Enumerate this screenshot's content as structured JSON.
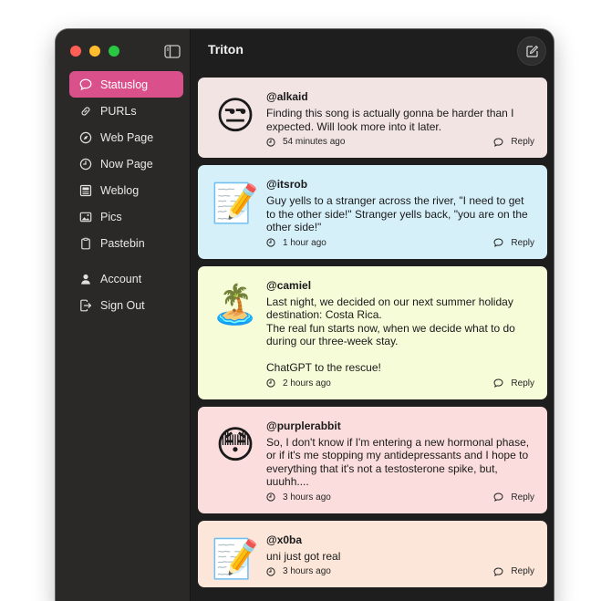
{
  "app": {
    "title": "Triton"
  },
  "sidebar": {
    "items": [
      {
        "label": "Statuslog",
        "icon": "speech-bubble-icon",
        "active": true
      },
      {
        "label": "PURLs",
        "icon": "link-icon"
      },
      {
        "label": "Web Page",
        "icon": "compass-icon"
      },
      {
        "label": "Now Page",
        "icon": "clock-icon"
      },
      {
        "label": "Weblog",
        "icon": "newspaper-icon"
      },
      {
        "label": "Pics",
        "icon": "photo-icon"
      },
      {
        "label": "Pastebin",
        "icon": "clipboard-icon"
      }
    ],
    "account_items": [
      {
        "label": "Account",
        "icon": "person-icon"
      },
      {
        "label": "Sign Out",
        "icon": "sign-out-icon"
      }
    ]
  },
  "feed": {
    "reply_label": "Reply",
    "posts": [
      {
        "handle": "@alkaid",
        "avatar": "😒",
        "text": "Finding this song is actually gonna be harder than I expected. Will look more into it later.",
        "time": "54 minutes ago",
        "bg": "#f3e4e4"
      },
      {
        "handle": "@itsrob",
        "avatar": "📝",
        "text": "Guy yells to a stranger across the river, \"I need to get to the other side!\" Stranger yells back, \"you are on the other side!\"",
        "time": "1 hour ago",
        "bg": "#d6f0fa"
      },
      {
        "handle": "@camiel",
        "avatar": "🏝️",
        "text": "Last night, we decided on our next summer holiday destination: Costa Rica.\nThe real fun starts now, when we decide what to do during our three-week stay.\n\nChatGPT to the rescue!",
        "time": "2 hours ago",
        "bg": "#f6fbd8"
      },
      {
        "handle": "@purplerabbit",
        "avatar": "😳",
        "text": "So, I don't know if I'm entering a new hormonal phase, or if it's me stopping my antidepressants and I hope to everything that it's not a testosterone spike, but, uuuhh....",
        "time": "3 hours ago",
        "bg": "#fbdddd"
      },
      {
        "handle": "@x0ba",
        "avatar": "📝",
        "text": "uni just got real",
        "time": "3 hours ago",
        "bg": "#fbe6d9"
      }
    ]
  }
}
